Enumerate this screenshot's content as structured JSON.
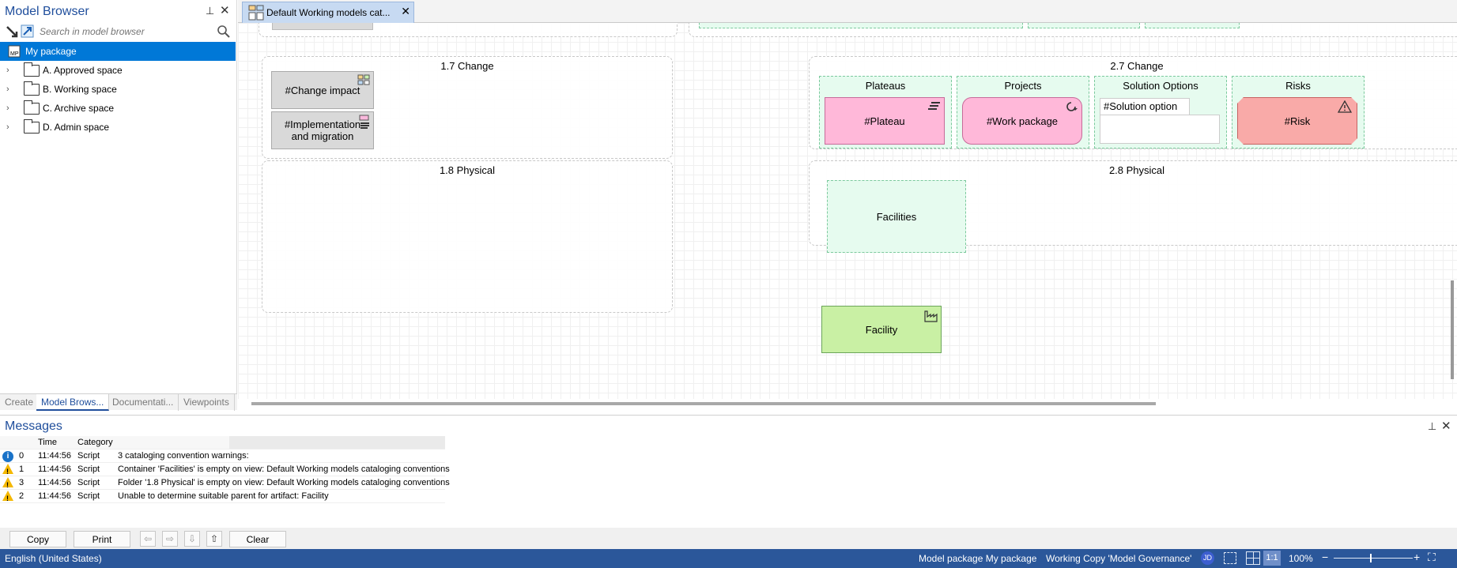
{
  "model_browser": {
    "title": "Model Browser",
    "search_placeholder": "Search in model browser",
    "items": [
      {
        "label": "My package",
        "selected": true
      },
      {
        "label": "A. Approved space"
      },
      {
        "label": "B. Working space"
      },
      {
        "label": "C. Archive space"
      },
      {
        "label": "D. Admin space"
      }
    ],
    "tabs": [
      "Create",
      "Model Brows...",
      "Documentati...",
      "Viewpoints"
    ]
  },
  "document_tab": {
    "label": "Default Working models cat..."
  },
  "diagram": {
    "group_17": {
      "title": "1.7 Change",
      "elements": [
        "#Change impact",
        "#Implementation and migration"
      ]
    },
    "group_18": {
      "title": "1.8 Physical"
    },
    "group_27": {
      "title": "2.7 Change",
      "lanes": [
        {
          "title": "Plateaus",
          "element": "#Plateau"
        },
        {
          "title": "Projects",
          "element": "#Work package"
        },
        {
          "title": "Solution Options",
          "element": "#Solution option"
        },
        {
          "title": "Risks",
          "element": "#Risk"
        }
      ]
    },
    "group_28": {
      "title": "2.8 Physical",
      "lane": "Facilities"
    },
    "facility": "Facility"
  },
  "messages": {
    "title": "Messages",
    "columns": [
      "Time",
      "Category"
    ],
    "rows": [
      {
        "icon": "info",
        "id": "0",
        "time": "11:44:56",
        "category": "Script",
        "text": "3 cataloging convention warnings:"
      },
      {
        "icon": "warning",
        "id": "1",
        "time": "11:44:56",
        "category": "Script",
        "text": "Container 'Facilities' is empty on view: Default Working models cataloging conventions"
      },
      {
        "icon": "warning",
        "id": "3",
        "time": "11:44:56",
        "category": "Script",
        "text": "Folder '1.8 Physical' is empty on view: Default Working models cataloging conventions"
      },
      {
        "icon": "warning",
        "id": "2",
        "time": "11:44:56",
        "category": "Script",
        "text": "Unable to determine suitable parent for artifact: Facility"
      }
    ],
    "buttons": {
      "copy": "Copy",
      "print": "Print",
      "clear": "Clear"
    }
  },
  "status_bar": {
    "language": "English (United States)",
    "model_package": "Model package My package",
    "working_copy": "Working Copy 'Model Governance'",
    "user": "JD",
    "scale": "1:1",
    "zoom": "100%"
  }
}
